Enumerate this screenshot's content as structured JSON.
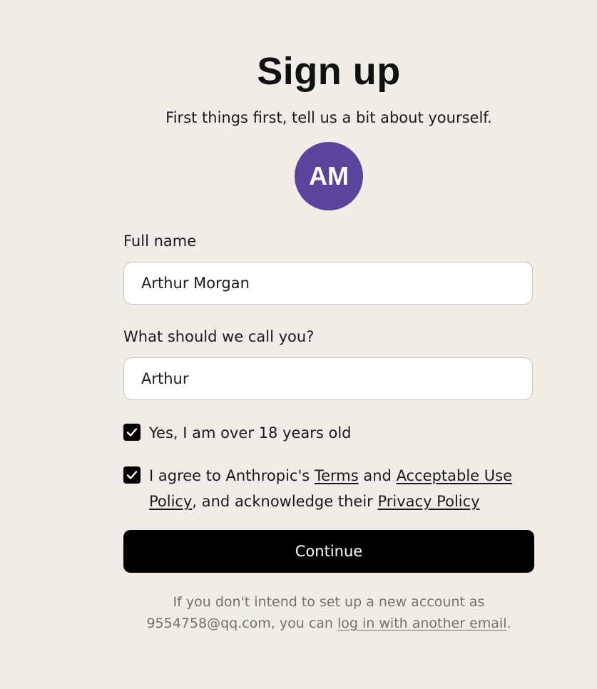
{
  "header": {
    "title": "Sign up",
    "subtitle": "First things first, tell us a bit about yourself."
  },
  "avatar": {
    "initials": "AM",
    "color": "#5a449c"
  },
  "form": {
    "full_name": {
      "label": "Full name",
      "value": "Arthur Morgan"
    },
    "nickname": {
      "label": "What should we call you?",
      "value": "Arthur"
    },
    "age_check": {
      "checked": true,
      "label": "Yes, I am over 18 years old"
    },
    "terms_check": {
      "checked": true,
      "text_1": "I agree to Anthropic's ",
      "terms_link": "Terms",
      "text_2": " and ",
      "aup_link": "Acceptable Use Policy",
      "text_3": ", and acknowledge their ",
      "privacy_link": "Privacy Policy"
    },
    "continue_label": "Continue"
  },
  "footer": {
    "text_1": "If you don't intend to set up a new account as 9554758@qq.com, you can ",
    "link": "log in with another email",
    "text_2": "."
  },
  "colors": {
    "background": "#f0ede6",
    "button": "#000000",
    "muted_text": "#75716b"
  }
}
